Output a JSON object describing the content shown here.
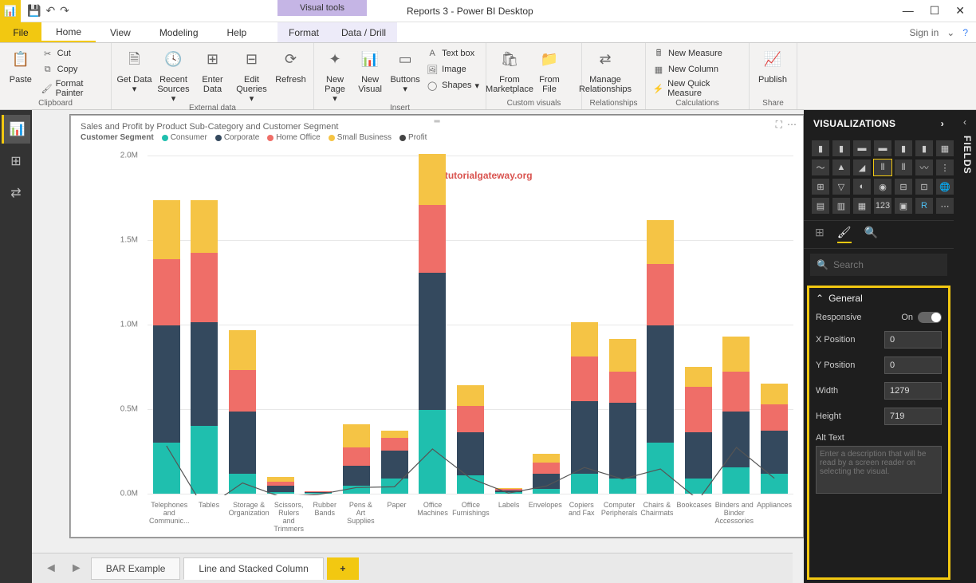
{
  "window": {
    "title": "Reports 3 - Power BI Desktop",
    "visual_tools": "Visual tools",
    "sign_in": "Sign in"
  },
  "tabs": {
    "file": "File",
    "home": "Home",
    "view": "View",
    "modeling": "Modeling",
    "help": "Help",
    "format": "Format",
    "datadrill": "Data / Drill"
  },
  "ribbon": {
    "clipboard": {
      "label": "Clipboard",
      "paste": "Paste",
      "cut": "Cut",
      "copy": "Copy",
      "format_painter": "Format Painter"
    },
    "external": {
      "label": "External data",
      "get": "Get Data",
      "recent": "Recent Sources",
      "enter": "Enter Data",
      "edit": "Edit Queries",
      "refresh": "Refresh"
    },
    "insert": {
      "label": "Insert",
      "newpage": "New Page",
      "newvisual": "New Visual",
      "buttons": "Buttons",
      "textbox": "Text box",
      "image": "Image",
      "shapes": "Shapes"
    },
    "custom": {
      "label": "Custom visuals",
      "marketplace": "From Marketplace",
      "file": "From File"
    },
    "rel": {
      "label": "Relationships",
      "manage": "Manage Relationships"
    },
    "calc": {
      "label": "Calculations",
      "measure": "New Measure",
      "column": "New Column",
      "quick": "New Quick Measure"
    },
    "share": {
      "label": "Share",
      "publish": "Publish"
    }
  },
  "visual": {
    "title": "Sales and Profit by Product Sub-Category and Customer Segment",
    "legend_label": "Customer Segment",
    "legend": [
      "Consumer",
      "Corporate",
      "Home Office",
      "Small Business",
      "Profit"
    ],
    "watermark": "©tutorialgateway.org"
  },
  "page_tabs": {
    "t1": "BAR Example",
    "t2": "Line and Stacked Column"
  },
  "viz": {
    "header": "VISUALIZATIONS",
    "fields": "FIELDS",
    "search": "Search",
    "general": "General",
    "responsive": "Responsive",
    "on": "On",
    "xpos": "X Position",
    "xpos_v": "0",
    "ypos": "Y Position",
    "ypos_v": "0",
    "width": "Width",
    "width_v": "1279",
    "height": "Height",
    "height_v": "719",
    "alt": "Alt Text",
    "alt_ph": "Enter a description that will be read by a screen reader on selecting the visual."
  },
  "chart_data": {
    "type": "bar",
    "title": "Sales and Profit by Product Sub-Category and Customer Segment",
    "xlabel": "",
    "ylabel": "",
    "ylim": [
      0,
      2200000
    ],
    "yticks": [
      "0.0M",
      "0.5M",
      "1.0M",
      "1.5M",
      "2.0M"
    ],
    "categories": [
      "Telephones and Communic...",
      "Tables",
      "Storage & Organization",
      "Scissors, Rulers and Trimmers",
      "Rubber Bands",
      "Pens & Art Supplies",
      "Paper",
      "Office Machines",
      "Office Furnishings",
      "Labels",
      "Envelopes",
      "Copiers and Fax",
      "Computer Peripherals",
      "Chairs & Chairmats",
      "Bookcases",
      "Binders and Binder Accessories",
      "Appliances"
    ],
    "series": [
      {
        "name": "Consumer",
        "color": "#1fbfae",
        "values": [
          330000,
          440000,
          130000,
          10000,
          5000,
          50000,
          100000,
          540000,
          120000,
          8000,
          30000,
          130000,
          100000,
          330000,
          100000,
          170000,
          130000
        ]
      },
      {
        "name": "Corporate",
        "color": "#34495e",
        "values": [
          760000,
          670000,
          400000,
          40000,
          8000,
          130000,
          180000,
          890000,
          280000,
          12000,
          100000,
          470000,
          490000,
          760000,
          300000,
          360000,
          280000
        ]
      },
      {
        "name": "Home Office",
        "color": "#ef6e68",
        "values": [
          430000,
          450000,
          270000,
          30000,
          3000,
          120000,
          80000,
          440000,
          170000,
          10000,
          70000,
          290000,
          200000,
          400000,
          290000,
          260000,
          170000
        ]
      },
      {
        "name": "Small Business",
        "color": "#f5c445",
        "values": [
          380000,
          340000,
          260000,
          30000,
          2000,
          150000,
          50000,
          330000,
          130000,
          8000,
          60000,
          220000,
          210000,
          280000,
          130000,
          225000,
          135000
        ]
      }
    ],
    "line_series": {
      "name": "Profit",
      "color": "#444",
      "values": [
        320000,
        -90000,
        80000,
        -10000,
        5000,
        50000,
        55000,
        300000,
        110000,
        14000,
        60000,
        180000,
        105000,
        170000,
        -30000,
        310000,
        110000
      ]
    }
  }
}
